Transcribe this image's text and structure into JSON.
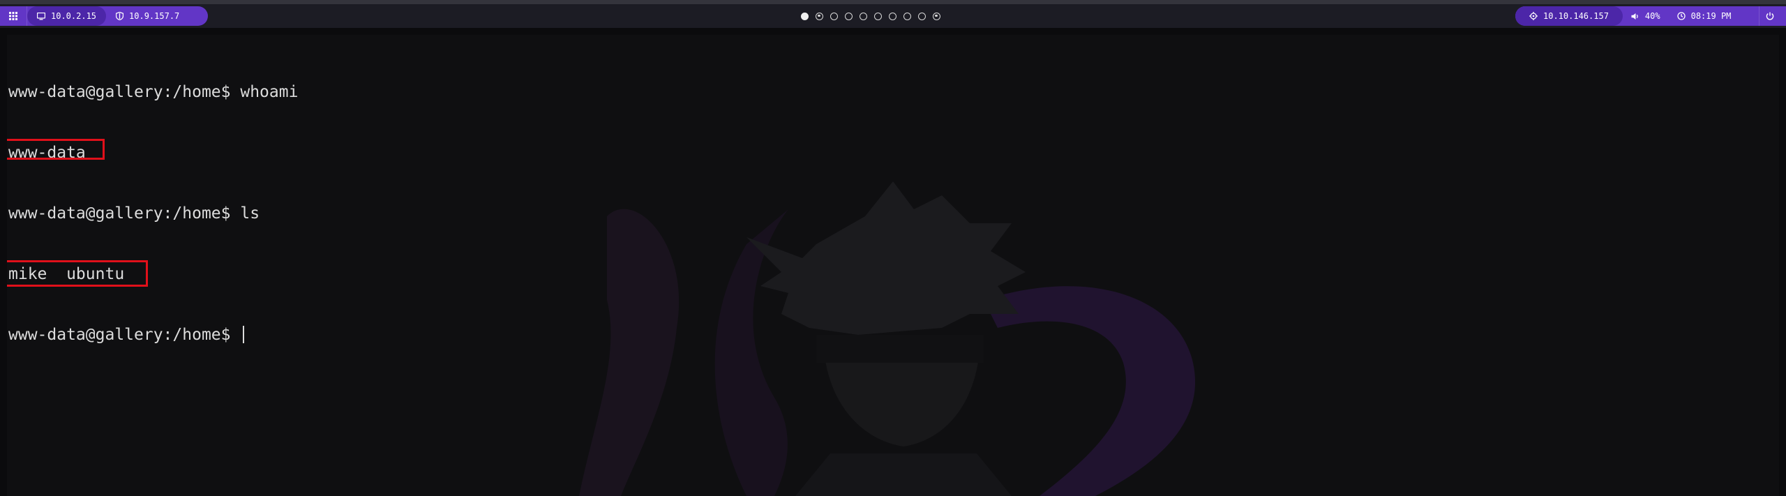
{
  "topbar": {
    "left": {
      "menu_icon": "grid-icon",
      "local_ip": "10.0.2.15",
      "local_ip_icon": "monitor-icon",
      "vpn_ip": "10.9.157.7",
      "vpn_ip_icon": "shield-icon"
    },
    "workspaces": [
      {
        "state": "active"
      },
      {
        "state": "occupied"
      },
      {
        "state": "empty"
      },
      {
        "state": "empty"
      },
      {
        "state": "empty"
      },
      {
        "state": "empty"
      },
      {
        "state": "empty"
      },
      {
        "state": "empty"
      },
      {
        "state": "empty"
      },
      {
        "state": "occupied"
      }
    ],
    "right": {
      "target_ip": "10.10.146.157",
      "target_icon": "target-icon",
      "volume": "40%",
      "volume_icon": "speaker-icon",
      "time": "08:19 PM",
      "clock_icon": "clock-icon",
      "power_icon": "power-icon"
    },
    "accent_color": "#6236c6"
  },
  "terminal": {
    "lines": [
      {
        "prompt": "www-data@gallery:/home$",
        "command": "whoami"
      },
      {
        "output": "www-data",
        "highlighted": true
      },
      {
        "prompt": "www-data@gallery:/home$",
        "command": "ls"
      },
      {
        "output": "mike  ubuntu",
        "highlighted": true
      },
      {
        "prompt": "www-data@gallery:/home$",
        "command": ""
      }
    ],
    "highlight_color": "#e0101a"
  }
}
